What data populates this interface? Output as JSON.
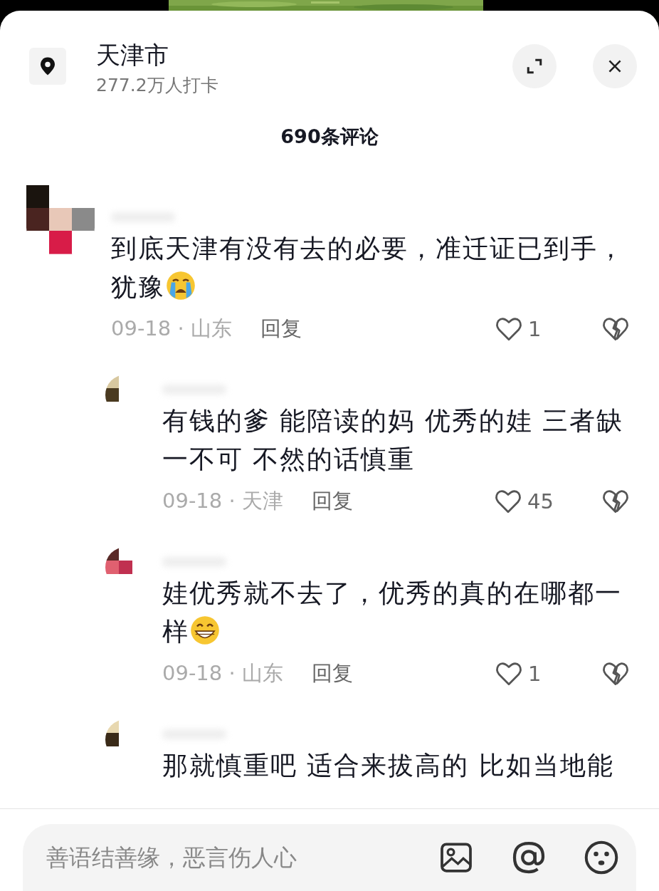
{
  "location": {
    "title": "天津市",
    "checkins": "277.2万人打卡"
  },
  "comment_count": "690条评论",
  "comments": [
    {
      "text": "到底天津有没有去的必要，准迁证已到手，犹豫",
      "emoji": {
        "kind": "crying"
      },
      "meta": "09-18 · 山东",
      "reply": "回复",
      "likes": "1",
      "replies": [
        {
          "text": "有钱的爹 能陪读的妈 优秀的娃 三者缺一不可 不然的话慎重",
          "meta": "09-18 · 天津",
          "reply": "回复",
          "likes": "45"
        },
        {
          "text": "娃优秀就不去了，优秀的真的在哪都一样",
          "emoji": {
            "kind": "grinning"
          },
          "meta": "09-18 · 山东",
          "reply": "回复",
          "likes": "1"
        },
        {
          "text": "那就慎重吧 适合来拔高的 比如当地能"
        }
      ]
    }
  ],
  "input": {
    "placeholder": "善语结善缘，恶言伤人心"
  }
}
